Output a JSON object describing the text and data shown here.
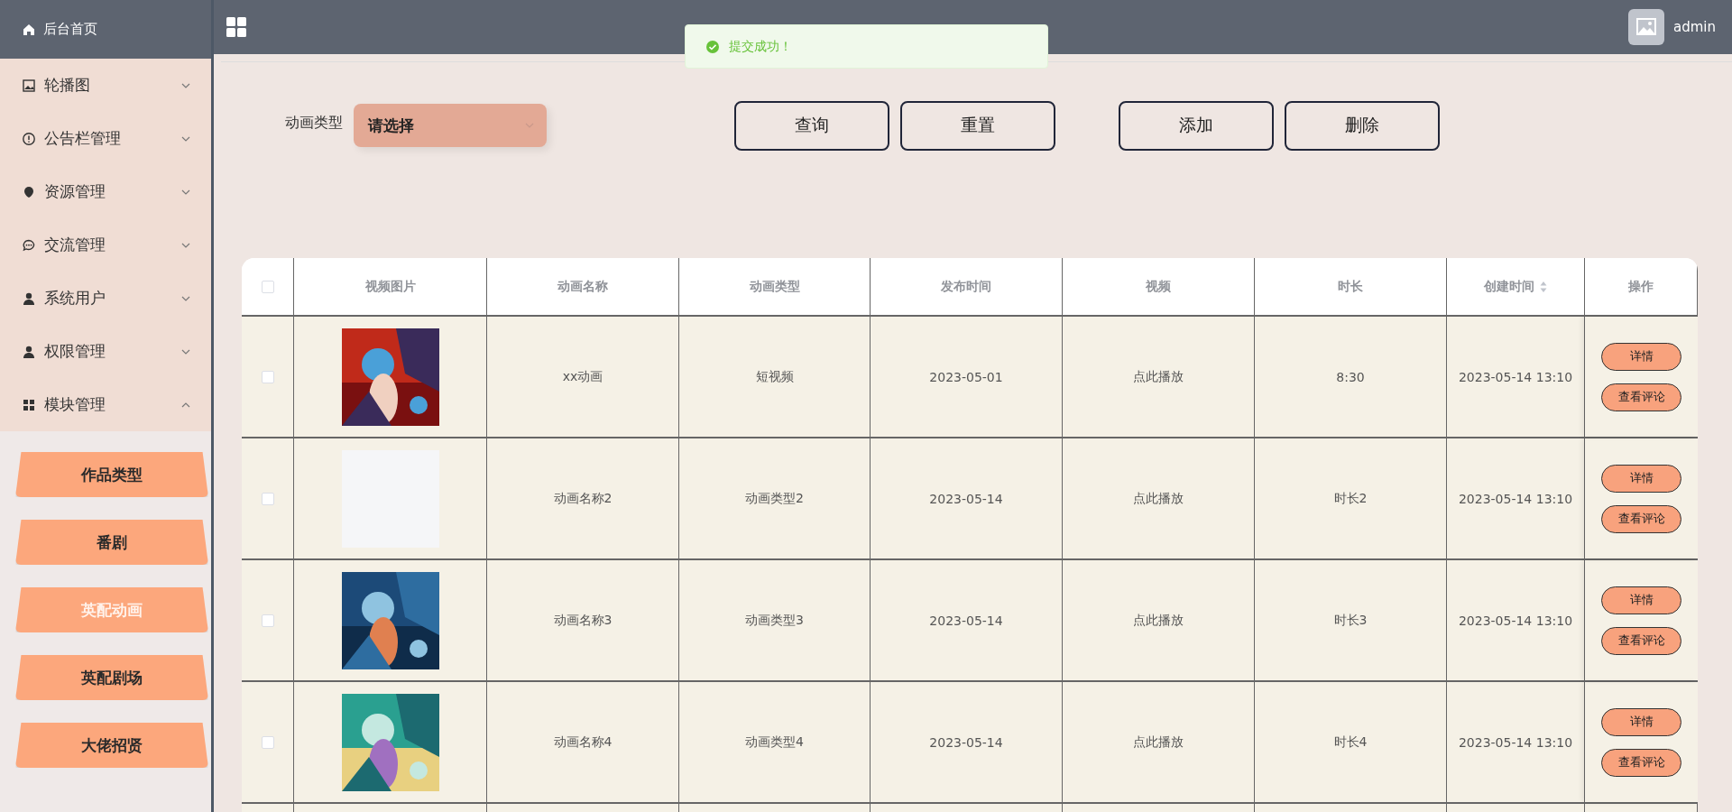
{
  "sidebar": {
    "home": "后台首页",
    "menus": [
      {
        "label": "轮播图",
        "expanded": false
      },
      {
        "label": "公告栏管理",
        "expanded": false
      },
      {
        "label": "资源管理",
        "expanded": false
      },
      {
        "label": "交流管理",
        "expanded": false
      },
      {
        "label": "系统用户",
        "expanded": false
      },
      {
        "label": "权限管理",
        "expanded": false
      },
      {
        "label": "模块管理",
        "expanded": true,
        "children": [
          {
            "label": "作品类型",
            "selected": false
          },
          {
            "label": "番剧",
            "selected": false
          },
          {
            "label": "英配动画",
            "selected": true
          },
          {
            "label": "英配剧场",
            "selected": false
          },
          {
            "label": "大佬招贤",
            "selected": false
          }
        ]
      }
    ]
  },
  "topbar": {
    "user": "admin"
  },
  "toast": {
    "message": "提交成功！"
  },
  "filter": {
    "label": "动画类型",
    "select": {
      "value": "请选择"
    },
    "search_buttons": [
      "查询",
      "重置"
    ],
    "edit_buttons": [
      "添加",
      "删除"
    ]
  },
  "table": {
    "header_checkbox": {
      "checked": false
    },
    "columns": [
      {
        "label": "视频图片",
        "sortable": false
      },
      {
        "label": "动画名称",
        "sortable": false
      },
      {
        "label": "动画类型",
        "sortable": false
      },
      {
        "label": "发布时间",
        "sortable": false
      },
      {
        "label": "视频",
        "sortable": false
      },
      {
        "label": "时长",
        "sortable": false
      },
      {
        "label": "创建时间",
        "sortable": true
      },
      {
        "label": "操作",
        "sortable": false
      }
    ],
    "rows": [
      {
        "checked": false,
        "cells": [
          {
            "kind": "picture"
          },
          {
            "kind": "text",
            "text": "xx动画"
          },
          {
            "kind": "text",
            "text": "短视频"
          },
          {
            "kind": "text",
            "text": "2023-05-01"
          },
          {
            "kind": "text",
            "text": "点此播放"
          },
          {
            "kind": "text",
            "text": "8:30"
          },
          {
            "kind": "text",
            "text": "2023-05-14 13:10"
          },
          {
            "kind": "actions",
            "actions": [
              "详情",
              "查看评论"
            ]
          }
        ]
      },
      {
        "checked": false,
        "cells": [
          {
            "kind": "empty_image"
          },
          {
            "kind": "text",
            "text": "动画名称2"
          },
          {
            "kind": "text",
            "text": "动画类型2"
          },
          {
            "kind": "text",
            "text": "2023-05-14"
          },
          {
            "kind": "text",
            "text": "点此播放"
          },
          {
            "kind": "text",
            "text": "时长2"
          },
          {
            "kind": "text",
            "text": "2023-05-14 13:10"
          },
          {
            "kind": "actions",
            "actions": [
              "详情",
              "查看评论"
            ]
          }
        ]
      },
      {
        "checked": false,
        "cells": [
          {
            "kind": "picture"
          },
          {
            "kind": "text",
            "text": "动画名称3"
          },
          {
            "kind": "text",
            "text": "动画类型3"
          },
          {
            "kind": "text",
            "text": "2023-05-14"
          },
          {
            "kind": "text",
            "text": "点此播放"
          },
          {
            "kind": "text",
            "text": "时长3"
          },
          {
            "kind": "text",
            "text": "2023-05-14 13:10"
          },
          {
            "kind": "actions",
            "actions": [
              "详情",
              "查看评论"
            ]
          }
        ]
      },
      {
        "checked": false,
        "cells": [
          {
            "kind": "picture"
          },
          {
            "kind": "text",
            "text": "动画名称4"
          },
          {
            "kind": "text",
            "text": "动画类型4"
          },
          {
            "kind": "text",
            "text": "2023-05-14"
          },
          {
            "kind": "text",
            "text": "点此播放"
          },
          {
            "kind": "text",
            "text": "时长4"
          },
          {
            "kind": "text",
            "text": "2023-05-14 13:10"
          },
          {
            "kind": "actions",
            "actions": [
              "详情",
              "查看评论"
            ]
          }
        ]
      }
    ]
  }
}
